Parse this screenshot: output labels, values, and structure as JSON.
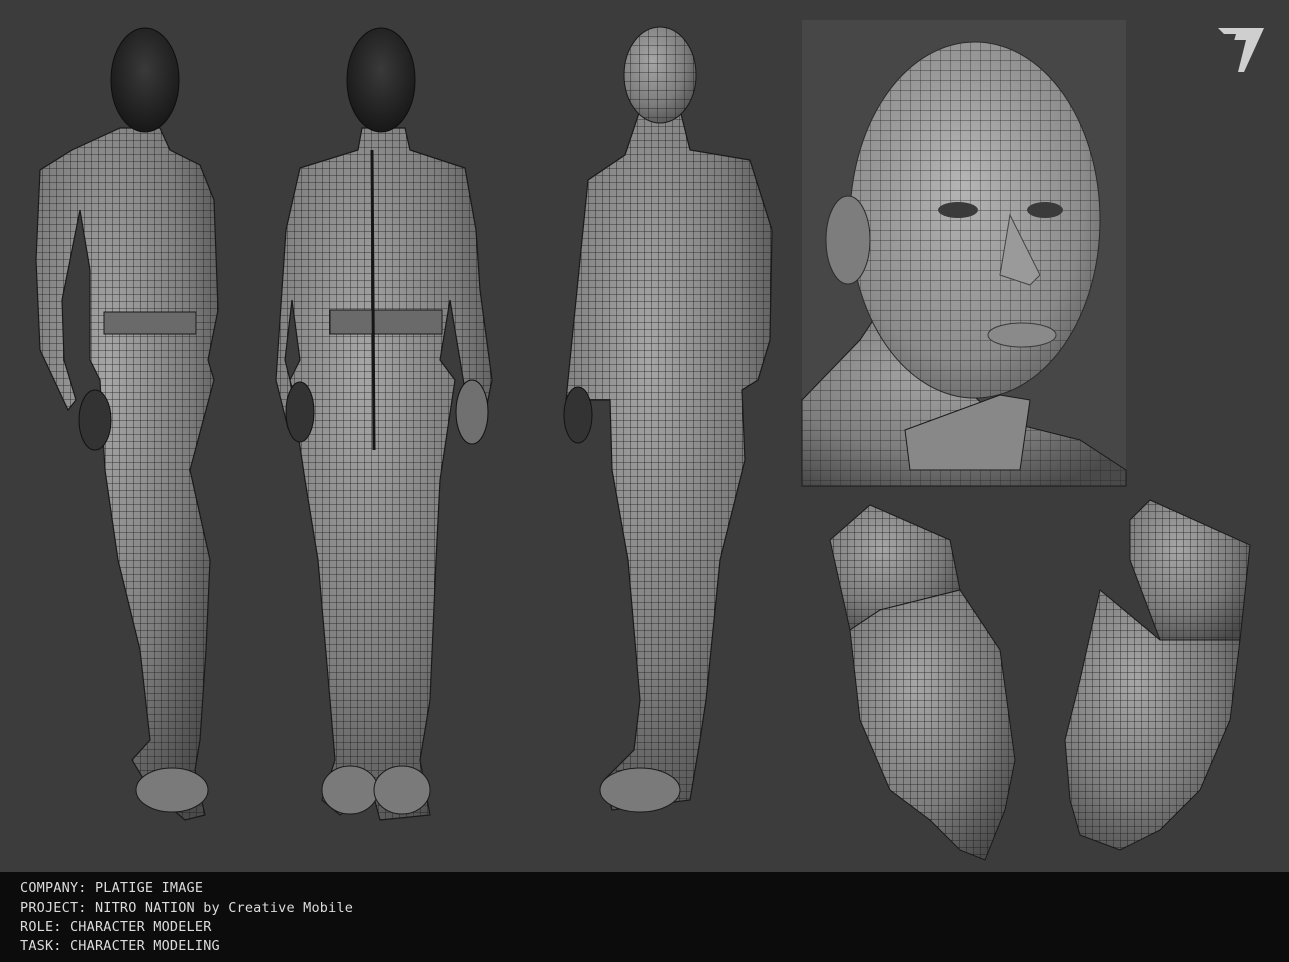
{
  "background_color": "#3c3c3c",
  "footer_color": "#0c0c0c",
  "logo": {
    "icon": "triangle-logo-icon"
  },
  "views": [
    {
      "name": "figure-three-quarter-view"
    },
    {
      "name": "figure-front-view"
    },
    {
      "name": "figure-back-view"
    },
    {
      "name": "head-closeup-view"
    },
    {
      "name": "glove-closeup-view-left"
    },
    {
      "name": "glove-closeup-view-right"
    }
  ],
  "credits": {
    "company": "COMPANY: PLATIGE IMAGE",
    "project": "PROJECT: NITRO NATION by Creative Mobile",
    "role": "ROLE: CHARACTER MODELER",
    "task": "TASK: CHARACTER MODELING"
  }
}
